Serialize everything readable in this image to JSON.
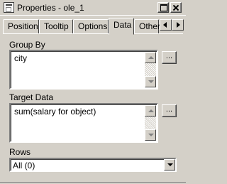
{
  "window": {
    "title": "Properties - ole_1",
    "icon": "properties-icon",
    "buttons": [
      "maximize-icon",
      "close-icon"
    ]
  },
  "tabs": [
    {
      "label": "Position",
      "active": false
    },
    {
      "label": "Tooltip",
      "active": false
    },
    {
      "label": "Options",
      "active": false
    },
    {
      "label": "Data",
      "active": true
    },
    {
      "label": "Other",
      "active": false
    }
  ],
  "tab_scroll": [
    "arrow-left-icon",
    "arrow-right-icon"
  ],
  "group_by": {
    "label": "Group By",
    "value": "city",
    "button_label": "..."
  },
  "target_data": {
    "label": "Target Data",
    "value": "sum(salary for object)",
    "button_label": "..."
  },
  "rows": {
    "label": "Rows",
    "selected": "All (0)"
  }
}
